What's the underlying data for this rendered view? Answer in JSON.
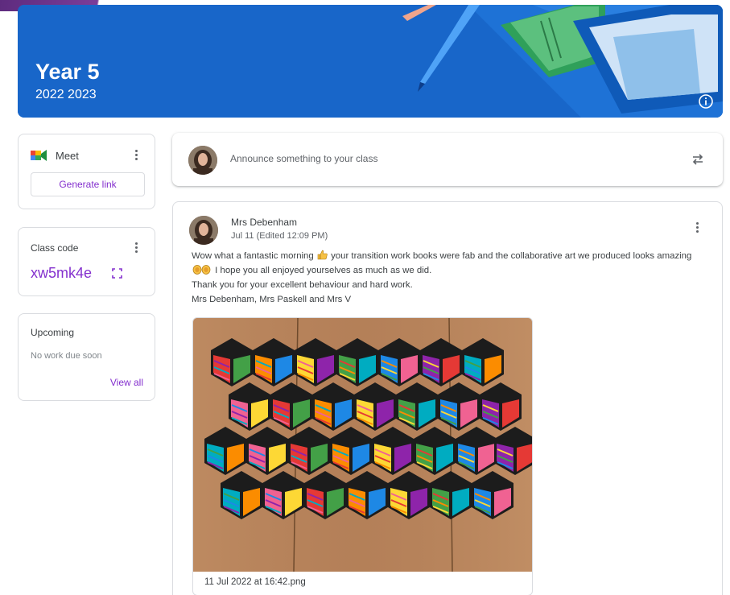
{
  "banner": {
    "title": "Year 5",
    "subtitle": "2022 2023",
    "info_icon": "info-icon"
  },
  "meet": {
    "label": "Meet",
    "button_label": "Generate link",
    "icon": "google-meet-icon"
  },
  "class_code": {
    "label": "Class code",
    "value": "xw5mk4e",
    "icon": "fullscreen-icon"
  },
  "upcoming": {
    "title": "Upcoming",
    "empty_text": "No work due soon",
    "link_label": "View all"
  },
  "announce": {
    "placeholder": "Announce something to your class",
    "icon": "repost-icon"
  },
  "post": {
    "author": "Mrs Debenham",
    "date": "Jul 11 (Edited 12:09 PM)",
    "body": {
      "line1": "Wow what a fantastic morning",
      "line1_rest": "your transition work books were fab and the collaborative art we produced looks amazing",
      "line2": "I hope you all enjoyed yourselves as much as we did.",
      "line3": "Thank you for your excellent behaviour and hard work.",
      "line4": "Mrs Debenham, Mrs Paskell and Mrs V"
    },
    "attachment_name": "11 Jul 2022 at 16:42.png"
  },
  "colors": {
    "banner": "#1866c9",
    "accent": "#8430ce"
  }
}
